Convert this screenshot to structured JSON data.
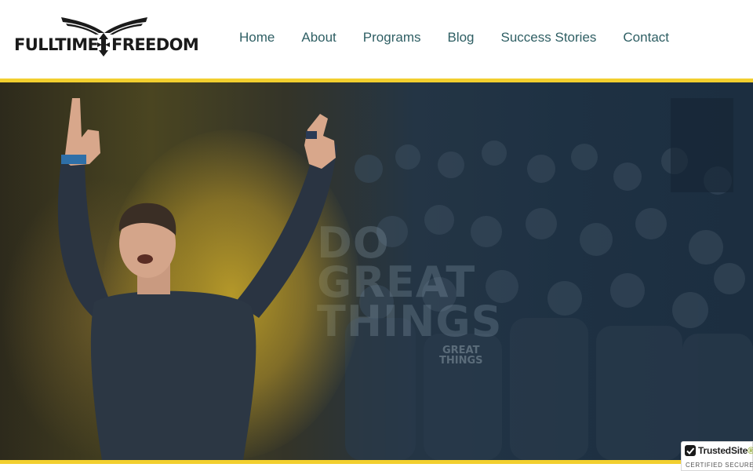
{
  "brand": {
    "logo_left": "FULLTIME",
    "logo_right": "FREEDOM",
    "colors": {
      "accent": "#f2cf2f",
      "nav": "#2f5f64",
      "logo": "#1a1a1a"
    }
  },
  "nav": {
    "items": [
      {
        "label": "Home"
      },
      {
        "label": "About"
      },
      {
        "label": "Programs"
      },
      {
        "label": "Blog"
      },
      {
        "label": "Success Stories"
      },
      {
        "label": "Contact"
      }
    ]
  },
  "hero": {
    "background_text": [
      "DO",
      "GREAT",
      "THINGS"
    ],
    "shirt_text": [
      "GREAT",
      "THINGS"
    ]
  },
  "badge": {
    "brand": "TrustedSite",
    "tm": "®",
    "subtitle": "CERTIFIED SECURE",
    "icon": "check-icon"
  }
}
